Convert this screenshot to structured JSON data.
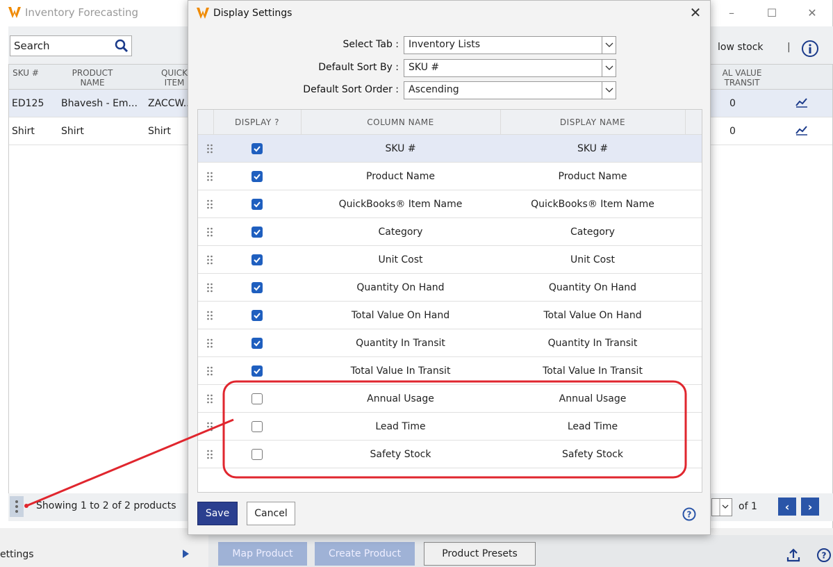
{
  "app": {
    "title": "Inventory Forecasting",
    "search_placeholder": "Search",
    "low_stock_label": "low stock",
    "columns": [
      "SKU #",
      "PRODUCT NAME",
      "QUICK ITEM",
      "AL VALUE TRANSIT"
    ],
    "rows": [
      {
        "sku": "ED125",
        "name": "Bhavesh - Em...",
        "item": "ZACCW...",
        "value": "0"
      },
      {
        "sku": "Shirt",
        "name": "Shirt",
        "item": "Shirt",
        "value": "0"
      }
    ],
    "showing_text": "Showing 1 to 2 of 2 products",
    "pager_of": "of 1",
    "settings_label": "ettings",
    "bottom_buttons": [
      "Map Product",
      "Create Product",
      "Product Presets"
    ]
  },
  "modal": {
    "title": "Display Settings",
    "select_tab_label": "Select Tab :",
    "select_tab_value": "Inventory Lists",
    "sort_by_label": "Default Sort By :",
    "sort_by_value": "SKU #",
    "sort_order_label": "Default Sort Order :",
    "sort_order_value": "Ascending",
    "headers": {
      "display": "DISPLAY ?",
      "column": "COLUMN NAME",
      "display_name": "DISPLAY NAME"
    },
    "rows": [
      {
        "checked": true,
        "column": "SKU #",
        "display_name": "SKU #"
      },
      {
        "checked": true,
        "column": "Product Name",
        "display_name": "Product Name"
      },
      {
        "checked": true,
        "column": "QuickBooks® Item Name",
        "display_name": "QuickBooks® Item Name"
      },
      {
        "checked": true,
        "column": "Category",
        "display_name": "Category"
      },
      {
        "checked": true,
        "column": "Unit Cost",
        "display_name": "Unit Cost"
      },
      {
        "checked": true,
        "column": "Quantity On Hand",
        "display_name": "Quantity On Hand"
      },
      {
        "checked": true,
        "column": "Total Value On Hand",
        "display_name": "Total Value On Hand"
      },
      {
        "checked": true,
        "column": "Quantity In Transit",
        "display_name": "Quantity In Transit"
      },
      {
        "checked": true,
        "column": "Total Value In Transit",
        "display_name": "Total Value In Transit"
      },
      {
        "checked": false,
        "column": "Annual Usage",
        "display_name": "Annual Usage"
      },
      {
        "checked": false,
        "column": "Lead Time",
        "display_name": "Lead Time"
      },
      {
        "checked": false,
        "column": "Safety Stock",
        "display_name": "Safety Stock"
      }
    ],
    "save_label": "Save",
    "cancel_label": "Cancel"
  },
  "colors": {
    "accent": "#2a55a8",
    "checkbox": "#1f5fbf",
    "highlight": "#e0262e",
    "save": "#2b3f8f"
  }
}
